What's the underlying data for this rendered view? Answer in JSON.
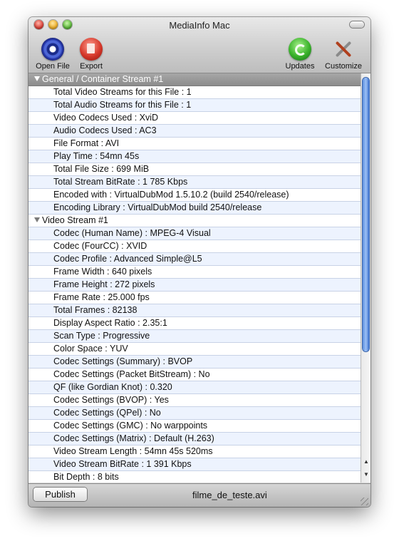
{
  "window": {
    "title": "MediaInfo Mac"
  },
  "toolbar": {
    "open_file": {
      "label": "Open File",
      "icon": "eye-icon"
    },
    "export": {
      "label": "Export",
      "icon": "export-icon"
    },
    "updates": {
      "label": "Updates",
      "icon": "update-arrows-icon"
    },
    "customize": {
      "label": "Customize",
      "icon": "tools-icon"
    }
  },
  "sections": [
    {
      "title": "General / Container Stream #1",
      "rows": [
        "Total Video Streams for this File : 1",
        "Total Audio Streams for this File : 1",
        "Video Codecs Used : XviD",
        "Audio Codecs Used : AC3",
        "File Format : AVI",
        "Play Time : 54mn 45s",
        "Total File Size : 699 MiB",
        "Total Stream BitRate : 1 785 Kbps",
        "Encoded with : VirtualDubMod 1.5.10.2 (build 2540/release)",
        "Encoding Library : VirtualDubMod build 2540/release"
      ]
    },
    {
      "title": "Video Stream #1",
      "rows": [
        "Codec (Human Name) : MPEG-4 Visual",
        "Codec (FourCC) : XVID",
        "Codec Profile : Advanced Simple@L5",
        "Frame Width : 640 pixels",
        "Frame Height : 272 pixels",
        "Frame Rate : 25.000 fps",
        "Total Frames : 82138",
        "Display Aspect Ratio : 2.35:1",
        "Scan Type : Progressive",
        "Color Space : YUV",
        "Codec Settings (Summary) : BVOP",
        "Codec Settings (Packet BitStream) : No",
        "QF (like Gordian Knot) : 0.320",
        "Codec Settings (BVOP) : Yes",
        "Codec Settings (QPel) : No",
        "Codec Settings (GMC) : No warppoints",
        "Codec Settings (Matrix) : Default (H.263)",
        "Video Stream Length : 54mn 45s 520ms",
        "Video Stream BitRate : 1 391 Kbps",
        "Bit Depth : 8 bits"
      ]
    }
  ],
  "footer": {
    "publish_label": "Publish",
    "filename": "filme_de_teste.avi"
  },
  "colors": {
    "row_alt": "#edf3fe",
    "section_header": "#8c8c8c",
    "scroll_thumb": "#5b8fe0"
  }
}
